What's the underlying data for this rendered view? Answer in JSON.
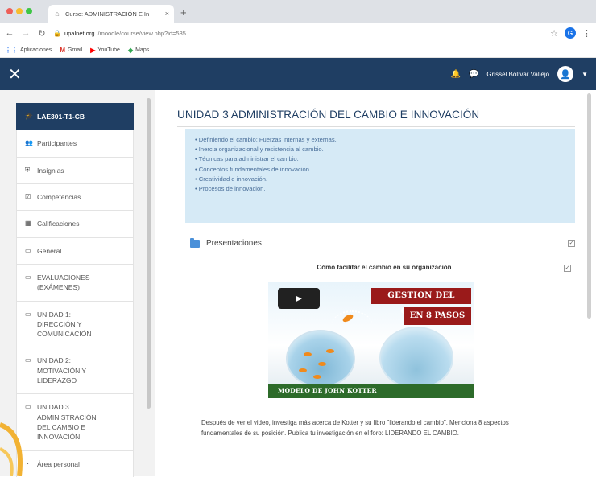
{
  "browser": {
    "tab_title": "Curso: ADMINISTRACIÓN E In",
    "url_domain": "upalnet.org",
    "url_path": "/moodle/course/view.php?id=535",
    "bookmarks": [
      {
        "label": "Aplicaciones",
        "icon": "apps-icon",
        "color": "#4285f4"
      },
      {
        "label": "Gmail",
        "icon": "gmail-icon",
        "color": "#d93025"
      },
      {
        "label": "YouTube",
        "icon": "youtube-icon",
        "color": "#ff0000"
      },
      {
        "label": "Maps",
        "icon": "maps-icon",
        "color": "#34a853"
      }
    ],
    "extension_letter": "G"
  },
  "navbar": {
    "user_name": "Grissel Bolívar Vallejo",
    "bg_color": "#1f3e63"
  },
  "drawer": {
    "items": [
      {
        "label": "LAE301-T1-CB",
        "icon": "graduation-cap-icon",
        "active": true
      },
      {
        "label": "Participantes",
        "icon": "users-icon"
      },
      {
        "label": "Insignias",
        "icon": "shield-icon"
      },
      {
        "label": "Competencias",
        "icon": "checklist-icon"
      },
      {
        "label": "Calificaciones",
        "icon": "table-icon"
      },
      {
        "label": "General",
        "icon": "folder-icon"
      },
      {
        "label": "EVALUACIONES\n(EXÁMENES)",
        "icon": "folder-icon"
      },
      {
        "label": "UNIDAD 1:\nDIRECCIÓN Y\nCOMUNICACIÓN",
        "icon": "folder-icon"
      },
      {
        "label": "UNIDAD 2:\nMOTIVACIÓN Y\nLIDERAZGO",
        "icon": "folder-icon"
      },
      {
        "label": "UNIDAD 3\nADMINISTRACIÓN\nDEL CAMBIO E\nINNOVACIÓN",
        "icon": "folder-icon"
      },
      {
        "label": "Área personal",
        "icon": "tachometer-icon"
      }
    ]
  },
  "main": {
    "title": "UNIDAD 3 ADMINISTRACIÓN DEL CAMBIO E INNOVACIÓN",
    "topics": [
      "Definiendo el cambio: Fuerzas internas y externas.",
      "Inercia organizacional y resistencia al cambio.",
      "Técnicas para administrar el cambio.",
      "Conceptos fundamentales de innovación.",
      "Creatividad e innovación.",
      "Procesos de innovación."
    ],
    "resource_label": "Presentaciones",
    "video_title": "Cómo facilitar el cambio en su organización",
    "video": {
      "banner_line1": "GESTION DEL CAMBIO",
      "banner_line2": "EN 8 PASOS",
      "footer_text": "MODELO DE JOHN KOTTER"
    },
    "instructions": "Después de ver el video, investiga más acerca de Kotter y su libro \"liderando el cambio\". Menciona 8 aspectos fundamentales de su posición. Publica tu investigación en el foro: LIDERANDO EL CAMBIO."
  }
}
